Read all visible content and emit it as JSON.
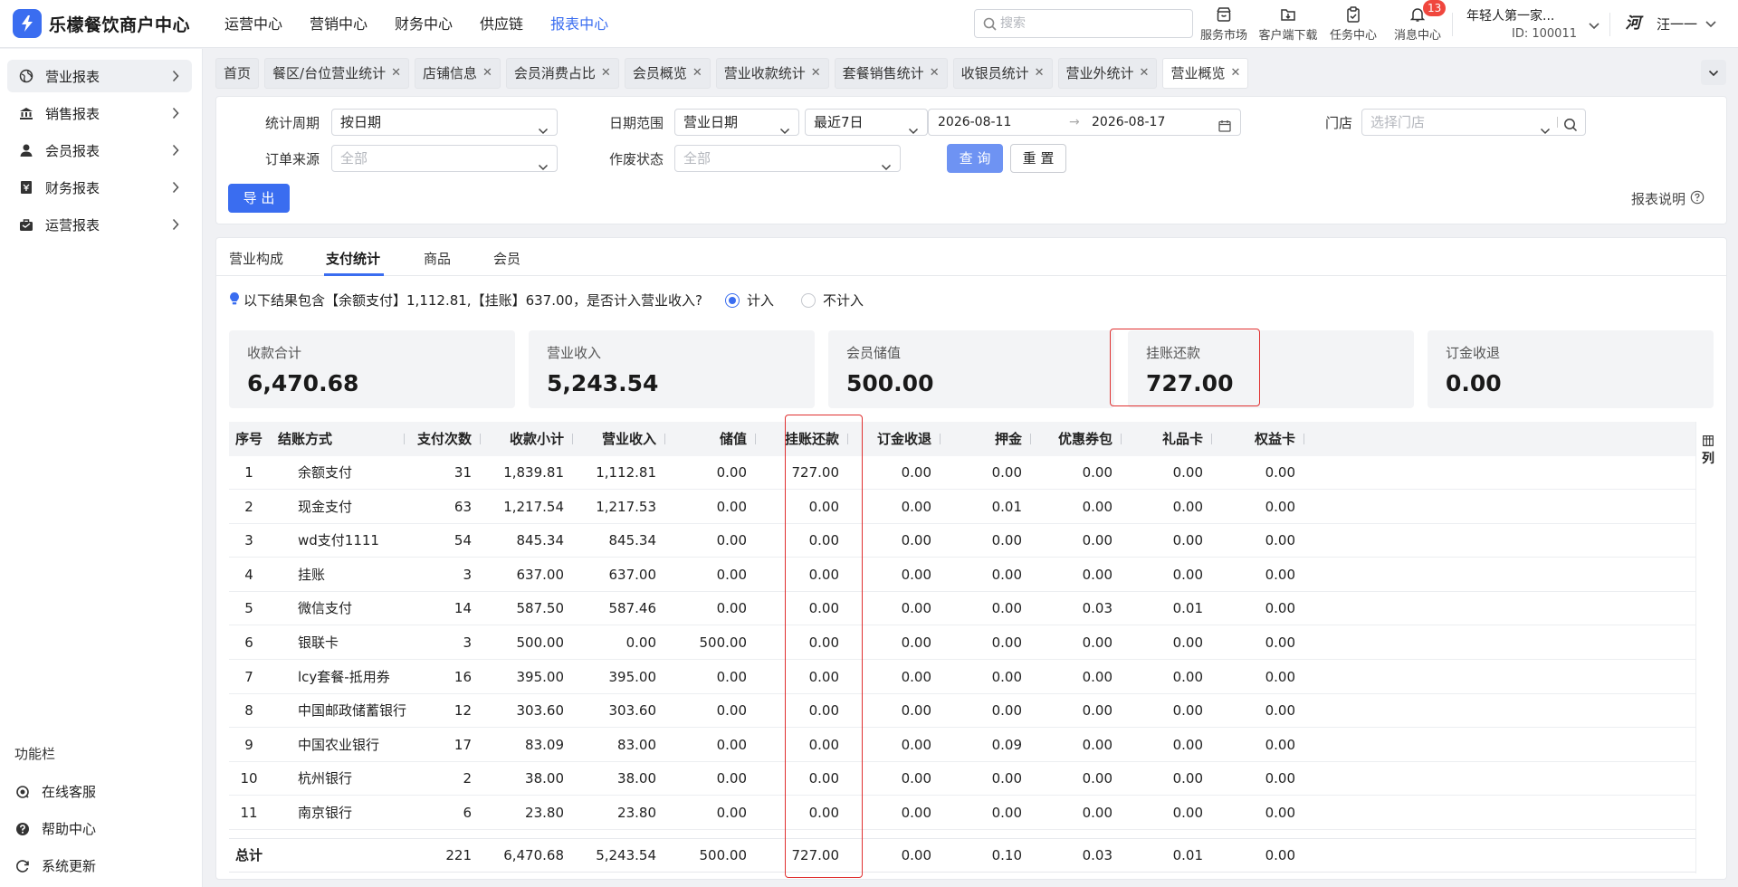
{
  "app": {
    "title": "乐檬餐饮商户中心",
    "brand_color": "#3a6df0"
  },
  "topnav": [
    "运营中心",
    "营销中心",
    "财务中心",
    "供应链",
    "报表中心"
  ],
  "topnav_active": 4,
  "search": {
    "placeholder": "搜索"
  },
  "tools": [
    {
      "label": "服务市场",
      "icon": "store-icon"
    },
    {
      "label": "客户端下载",
      "icon": "download-folder-icon"
    },
    {
      "label": "任务中心",
      "icon": "clipboard-icon"
    },
    {
      "label": "消息中心",
      "icon": "bell-icon",
      "badge": "13"
    }
  ],
  "store": {
    "name": "年轻人第一家...",
    "id": "ID: 100011"
  },
  "user": {
    "avatar_text": "河",
    "name": "汪一一"
  },
  "sidebar": {
    "items": [
      {
        "label": "营业报表",
        "icon": "globe-icon"
      },
      {
        "label": "销售报表",
        "icon": "bank-icon"
      },
      {
        "label": "会员报表",
        "icon": "user-icon"
      },
      {
        "label": "财务报表",
        "icon": "ledger-icon"
      },
      {
        "label": "运营报表",
        "icon": "briefcase-icon"
      }
    ],
    "active": 0,
    "function_title": "功能栏",
    "functions": [
      {
        "label": "在线客服",
        "icon": "headset-icon"
      },
      {
        "label": "帮助中心",
        "icon": "question-icon"
      },
      {
        "label": "系统更新",
        "icon": "refresh-icon"
      }
    ]
  },
  "page_tabs": [
    {
      "label": "首页",
      "closable": false
    },
    {
      "label": "餐区/台位营业统计",
      "closable": true
    },
    {
      "label": "店铺信息",
      "closable": true
    },
    {
      "label": "会员消费占比",
      "closable": true
    },
    {
      "label": "会员概览",
      "closable": true
    },
    {
      "label": "营业收款统计",
      "closable": true
    },
    {
      "label": "套餐销售统计",
      "closable": true
    },
    {
      "label": "收银员统计",
      "closable": true
    },
    {
      "label": "营业外统计",
      "closable": true
    },
    {
      "label": "营业概览",
      "closable": true,
      "active": true
    }
  ],
  "filters": {
    "period_label": "统计周期",
    "period_value": "按日期",
    "date_range_label": "日期范围",
    "date_type_value": "营业日期",
    "date_preset_value": "最近7日",
    "date_start": "2026-08-11",
    "date_end": "2026-08-17",
    "date_arrow": "→",
    "store_label": "门店",
    "store_placeholder": "选择门店",
    "order_source_label": "订单来源",
    "order_source_value": "全部",
    "void_status_label": "作废状态",
    "void_status_value": "全部",
    "query_button": "查 询",
    "reset_button": "重 置",
    "export_button": "导 出",
    "report_help": "报表说明"
  },
  "section_tabs": [
    "营业构成",
    "支付统计",
    "商品",
    "会员"
  ],
  "section_active": 1,
  "notice": {
    "text": "以下结果包含【余额支付】1,112.81,【挂账】637.00，是否计入营业收入?",
    "option_include": "计入",
    "option_exclude": "不计入",
    "selected": "计入"
  },
  "stats": [
    {
      "title": "收款合计",
      "value": "6,470.68"
    },
    {
      "title": "营业收入",
      "value": "5,243.54"
    },
    {
      "title": "会员储值",
      "value": "500.00"
    },
    {
      "title": "挂账还款",
      "value": "727.00",
      "highlighted": true
    },
    {
      "title": "订金收退",
      "value": "0.00"
    }
  ],
  "table": {
    "columns": [
      "序号",
      "结账方式",
      "支付次数",
      "收款小计",
      "营业收入",
      "储值",
      "挂账还款",
      "订金收退",
      "押金",
      "优惠券包",
      "礼品卡",
      "权益卡"
    ],
    "column_selector": "列",
    "rows": [
      [
        "1",
        "余额支付",
        "31",
        "1,839.81",
        "1,112.81",
        "0.00",
        "727.00",
        "0.00",
        "0.00",
        "0.00",
        "0.00",
        "0.00"
      ],
      [
        "2",
        "现金支付",
        "63",
        "1,217.54",
        "1,217.53",
        "0.00",
        "0.00",
        "0.00",
        "0.01",
        "0.00",
        "0.00",
        "0.00"
      ],
      [
        "3",
        "wd支付1111",
        "54",
        "845.34",
        "845.34",
        "0.00",
        "0.00",
        "0.00",
        "0.00",
        "0.00",
        "0.00",
        "0.00"
      ],
      [
        "4",
        "挂账",
        "3",
        "637.00",
        "637.00",
        "0.00",
        "0.00",
        "0.00",
        "0.00",
        "0.00",
        "0.00",
        "0.00"
      ],
      [
        "5",
        "微信支付",
        "14",
        "587.50",
        "587.46",
        "0.00",
        "0.00",
        "0.00",
        "0.00",
        "0.03",
        "0.01",
        "0.00"
      ],
      [
        "6",
        "银联卡",
        "3",
        "500.00",
        "0.00",
        "500.00",
        "0.00",
        "0.00",
        "0.00",
        "0.00",
        "0.00",
        "0.00"
      ],
      [
        "7",
        "lcy套餐-抵用券",
        "16",
        "395.00",
        "395.00",
        "0.00",
        "0.00",
        "0.00",
        "0.00",
        "0.00",
        "0.00",
        "0.00"
      ],
      [
        "8",
        "中国邮政储蓄银行",
        "12",
        "303.60",
        "303.60",
        "0.00",
        "0.00",
        "0.00",
        "0.00",
        "0.00",
        "0.00",
        "0.00"
      ],
      [
        "9",
        "中国农业银行",
        "17",
        "83.09",
        "83.00",
        "0.00",
        "0.00",
        "0.00",
        "0.09",
        "0.00",
        "0.00",
        "0.00"
      ],
      [
        "10",
        "杭州银行",
        "2",
        "38.00",
        "38.00",
        "0.00",
        "0.00",
        "0.00",
        "0.00",
        "0.00",
        "0.00",
        "0.00"
      ],
      [
        "11",
        "南京银行",
        "6",
        "23.80",
        "23.80",
        "0.00",
        "0.00",
        "0.00",
        "0.00",
        "0.00",
        "0.00",
        "0.00"
      ]
    ],
    "total": [
      "总计",
      "",
      "221",
      "6,470.68",
      "5,243.54",
      "500.00",
      "727.00",
      "0.00",
      "0.10",
      "0.03",
      "0.01",
      "0.00"
    ]
  },
  "colors": {
    "accent": "#3a6df0",
    "highlight": "#e03030",
    "badge": "#f0473e"
  }
}
